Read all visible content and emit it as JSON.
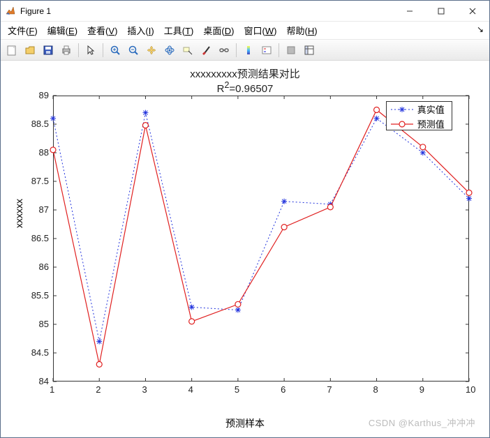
{
  "window": {
    "title": "Figure 1"
  },
  "menu": {
    "file": "文件",
    "file_u": "F",
    "edit": "编辑",
    "edit_u": "E",
    "view": "查看",
    "view_u": "V",
    "insert": "插入",
    "insert_u": "I",
    "tools": "工具",
    "tools_u": "T",
    "desktop": "桌面",
    "desktop_u": "D",
    "window_": "窗口",
    "window_u": "W",
    "help": "帮助",
    "help_u": "H"
  },
  "chart_data": {
    "type": "line",
    "title": "xxxxxxxxx预测结果对比",
    "subtitle_prefix": "R",
    "subtitle_value": "=0.96507",
    "xlabel": "预测样本",
    "ylabel": "xxxxxx",
    "x": [
      1,
      2,
      3,
      4,
      5,
      6,
      7,
      8,
      9,
      10
    ],
    "xlim": [
      1,
      10
    ],
    "ylim": [
      84,
      89
    ],
    "yticks": [
      84,
      84.5,
      85,
      85.5,
      86,
      86.5,
      87,
      87.5,
      88,
      88.5,
      89
    ],
    "series": [
      {
        "name": "真实值",
        "style": "blue-dotted-star",
        "values": [
          88.6,
          84.7,
          88.7,
          85.3,
          85.25,
          87.15,
          87.1,
          88.6,
          88.0,
          87.2
        ]
      },
      {
        "name": "预测值",
        "style": "red-line-circle",
        "values": [
          88.05,
          84.3,
          88.48,
          85.05,
          85.35,
          86.7,
          87.05,
          88.75,
          88.1,
          87.3
        ]
      }
    ],
    "legend_pos": {
      "x": 8.2,
      "y": 88.9
    }
  },
  "watermark": "CSDN @Karthus_冲冲冲"
}
